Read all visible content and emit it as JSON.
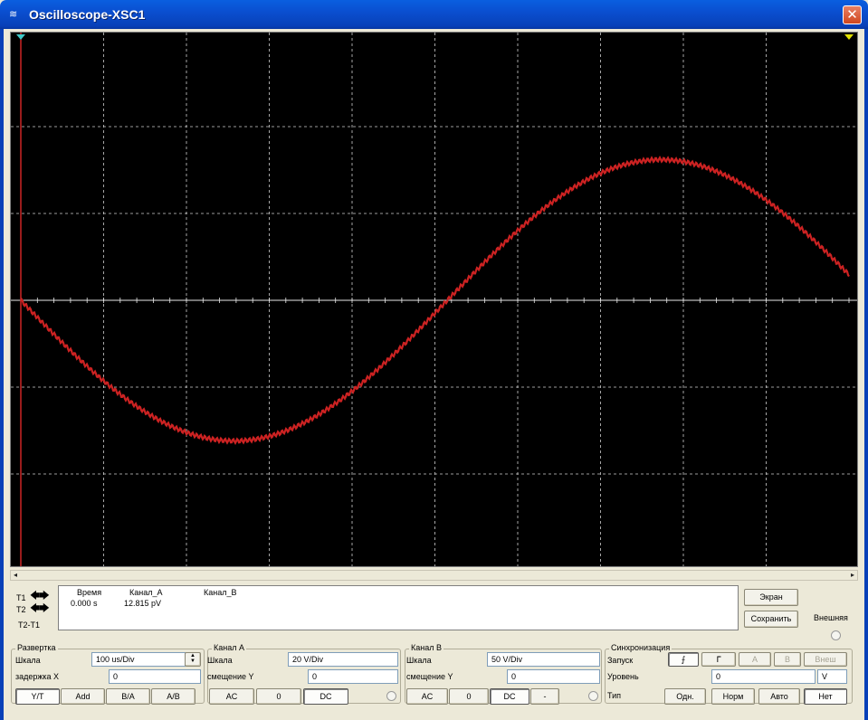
{
  "window": {
    "title": "Oscilloscope-XSC1",
    "close_glyph": "✕",
    "icon": "oscilloscope-icon"
  },
  "colors": {
    "trace_a": "#cc2222",
    "grid": "#cfcfcf",
    "screen": "#000000",
    "cursor_t1": "#ff3030",
    "cursor_marker": "#40c8c8",
    "cursor_marker_2": "#e0e000"
  },
  "chart_data": {
    "type": "line",
    "grid": true,
    "series": [
      {
        "channel": "A",
        "shape": "sine",
        "start_phase": "negative-going",
        "color": "#cc2222"
      }
    ]
  },
  "measurements": {
    "headers": {
      "time": "Время",
      "channel_a": "Канал_A",
      "channel_b": "Канал_B"
    },
    "row_t1": {
      "time": "0.000 s",
      "channel_a": "12.815 pV"
    },
    "t1_label": "T1",
    "t2_label": "T2",
    "t2t1_label": "T2-T1"
  },
  "side_buttons": {
    "screen": "Экран",
    "save": "Сохранить",
    "external": "Внешняя"
  },
  "timebase": {
    "group": "Развертка",
    "scale_label": "Шкала",
    "scale_value": "100 us/Div",
    "delay_label": "задержка X",
    "delay_value": "0",
    "modes": [
      "Y/T",
      "Add",
      "B/A",
      "A/B"
    ]
  },
  "channel_a": {
    "group": "Канал A",
    "scale_label": "Шкала",
    "scale_value": "20  V/Div",
    "offset_label": "смещение Y",
    "offset_value": "0",
    "coupling": [
      "AC",
      "0",
      "DC"
    ]
  },
  "channel_b": {
    "group": "Канал B",
    "scale_label": "Шкала",
    "scale_value": "50  V/Div",
    "offset_label": "смещение Y",
    "offset_value": "0",
    "coupling": [
      "AC",
      "0",
      "DC",
      "-"
    ]
  },
  "trigger": {
    "group": "Синхронизация",
    "edge_label": "Запуск",
    "edges": [
      "⨍",
      "ᒥ"
    ],
    "sources": [
      "A",
      "B",
      "Внеш"
    ],
    "level_label": "Уровень",
    "level_value": "0",
    "level_unit": "V",
    "type_label": "Тип",
    "types": [
      "Одн.",
      "Норм",
      "Авто",
      "Нет"
    ]
  }
}
